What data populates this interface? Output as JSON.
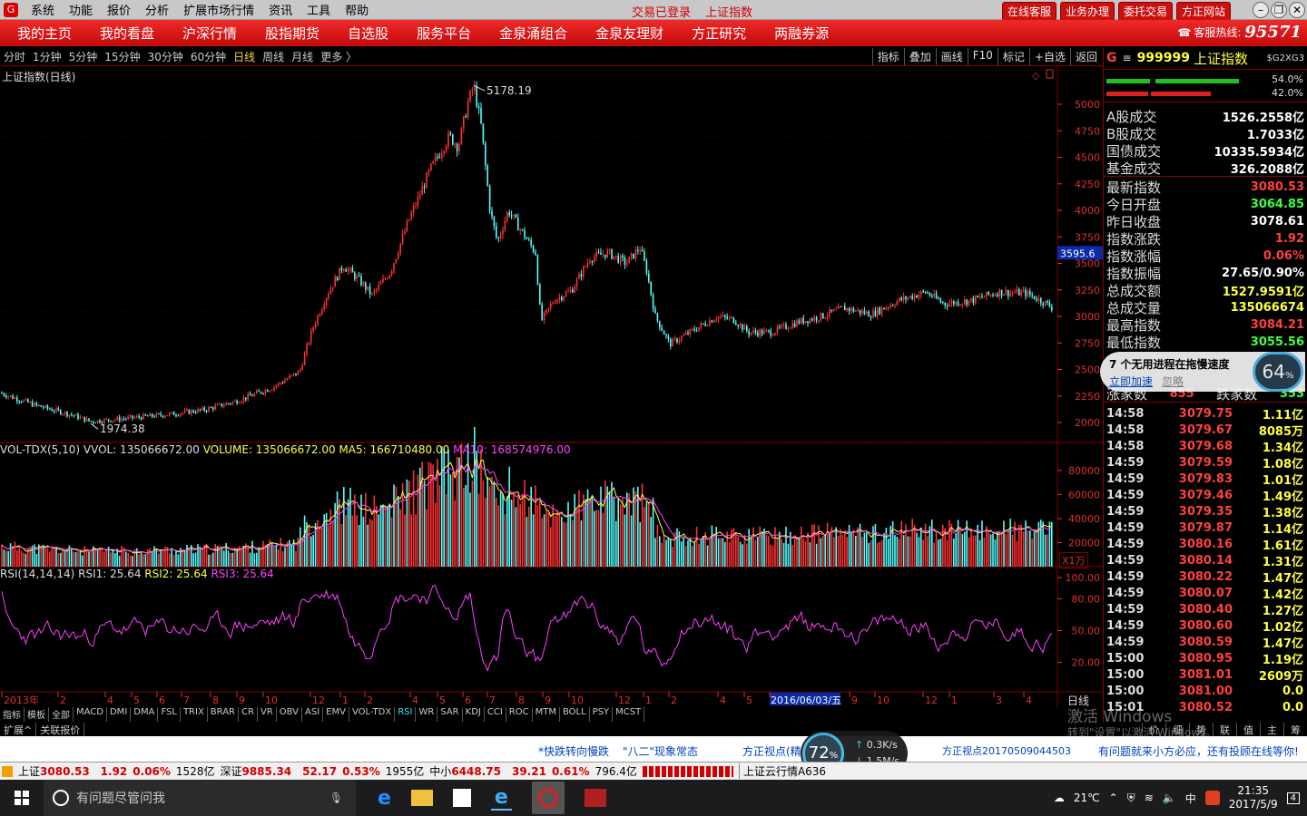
{
  "titlebar": {
    "logo": "G",
    "menu": [
      "系统",
      "功能",
      "报价",
      "分析",
      "扩展市场行情",
      "资讯",
      "工具",
      "帮助"
    ],
    "status_login": "交易已登录",
    "status_index": "上证指数",
    "buttons": [
      "在线客服",
      "业务办理",
      "委托交易",
      "方正网站"
    ]
  },
  "nav": {
    "items": [
      "我的主页",
      "我的看盘",
      "沪深行情",
      "股指期货",
      "自选股",
      "服务平台",
      "金泉涌组合",
      "金泉友理财",
      "方正研究",
      "两融券源"
    ],
    "hotline_label": "客服热线:",
    "hotline_number": "95571"
  },
  "periods": {
    "items": [
      "分时",
      "1分钟",
      "5分钟",
      "15分钟",
      "30分钟",
      "60分钟",
      "日线",
      "周线",
      "月线",
      "更多 〉"
    ],
    "active": "日线"
  },
  "toolbar": [
    "指标",
    "叠加",
    "画线",
    "F10",
    "标记",
    "+自选",
    "返回"
  ],
  "main_chart": {
    "title": "上证指数(日线)",
    "high_label": "5178.19",
    "low_label": "1974.38",
    "cursor_price": "3595.6",
    "y_ticks": [
      "5000",
      "4750",
      "4500",
      "4250",
      "4000",
      "3750",
      "3500",
      "3250",
      "3000",
      "2750",
      "2500",
      "2250",
      "2000"
    ],
    "colors": {
      "up": "#ff3232",
      "down": "#54ffff",
      "grid": "#800000"
    }
  },
  "volume_panel": {
    "title": "VOL-TDX(5,10)",
    "vvol": "VVOL: 135066672.00",
    "volume": "VOLUME: 135066672.00",
    "ma5": "MA5: 166710480.00",
    "ma10": "MA10: 168574976.00",
    "y_ticks": [
      "80000",
      "60000",
      "40000",
      "20000"
    ],
    "unit": "X1万"
  },
  "rsi_panel": {
    "title": "RSI(14,14,14)",
    "rsi1": "RSI1: 25.64",
    "rsi2": "RSI2: 25.64",
    "rsi3": "RSI3: 25.64",
    "y_ticks": [
      "100.00",
      "80.00",
      "50.00",
      "20.00"
    ]
  },
  "x_axis": {
    "labels": [
      "2013年",
      "2",
      "4",
      "5",
      "6",
      "7",
      "8",
      "9",
      "10",
      "12",
      "1",
      "2",
      "4",
      "5",
      "6",
      "7",
      "8",
      "9",
      "10",
      "12",
      "1",
      "2",
      "4",
      "5",
      "2016/06/03/五",
      "9",
      "10",
      "12",
      "1",
      "3",
      "4"
    ],
    "period_label": "日线"
  },
  "indicator_tabs": [
    "指标",
    "模板",
    "全部",
    "MACD",
    "DMI",
    "DMA",
    "FSL",
    "TRIX",
    "BRAR",
    "CR",
    "VR",
    "OBV",
    "ASI",
    "EMV",
    "VOL-TDX",
    "RSI",
    "WR",
    "SAR",
    "KDJ",
    "CCI",
    "ROC",
    "MTM",
    "BOLL",
    "PSY",
    "MCST"
  ],
  "active_indicator": "RSI",
  "bottom_tabs": [
    "扩展^",
    "关联报价"
  ],
  "right_panel": {
    "code": "999999",
    "name": "上证指数",
    "tag": "$G2XG3",
    "bar_pct1": "54.0%",
    "bar_pct2": "42.0%",
    "rows": [
      {
        "label": "A股成交",
        "value": "1526.2558亿",
        "color": "#ffffff"
      },
      {
        "label": "B股成交",
        "value": "1.7033亿",
        "color": "#ffffff"
      },
      {
        "label": "国债成交",
        "value": "10335.5934亿",
        "color": "#ffffff"
      },
      {
        "label": "基金成交",
        "value": "326.2088亿",
        "color": "#ffffff"
      },
      {
        "label": "最新指数",
        "value": "3080.53",
        "color": "#ff4040"
      },
      {
        "label": "今日开盘",
        "value": "3064.85",
        "color": "#40ff40"
      },
      {
        "label": "昨日收盘",
        "value": "3078.61",
        "color": "#ffffff"
      },
      {
        "label": "指数涨跌",
        "value": "1.92",
        "color": "#ff4040"
      },
      {
        "label": "指数涨幅",
        "value": "0.06%",
        "color": "#ff4040"
      },
      {
        "label": "指数振幅",
        "value": "27.65/0.90%",
        "color": "#ffffff"
      },
      {
        "label": "总成交额",
        "value": "1527.9591亿",
        "color": "#ffff40"
      },
      {
        "label": "总成交量",
        "value": "135066674",
        "color": "#ffff40"
      },
      {
        "label": "最高指数",
        "value": "3084.21",
        "color": "#ff4040"
      },
      {
        "label": "最低指数",
        "value": "3055.56",
        "color": "#40ff40"
      }
    ],
    "up_label": "涨家数",
    "up_count": "855",
    "down_label": "跌家数",
    "down_count": "353",
    "ticks": [
      {
        "t": "14:58",
        "p": "3079.75",
        "v": "1.11亿"
      },
      {
        "t": "14:58",
        "p": "3079.67",
        "v": "8085万"
      },
      {
        "t": "14:58",
        "p": "3079.68",
        "v": "1.34亿"
      },
      {
        "t": "14:59",
        "p": "3079.59",
        "v": "1.08亿"
      },
      {
        "t": "14:59",
        "p": "3079.83",
        "v": "1.01亿"
      },
      {
        "t": "14:59",
        "p": "3079.46",
        "v": "1.49亿"
      },
      {
        "t": "14:59",
        "p": "3079.35",
        "v": "1.38亿"
      },
      {
        "t": "14:59",
        "p": "3079.87",
        "v": "1.14亿"
      },
      {
        "t": "14:59",
        "p": "3080.16",
        "v": "1.61亿"
      },
      {
        "t": "14:59",
        "p": "3080.14",
        "v": "1.31亿"
      },
      {
        "t": "14:59",
        "p": "3080.22",
        "v": "1.47亿"
      },
      {
        "t": "14:59",
        "p": "3080.07",
        "v": "1.42亿"
      },
      {
        "t": "14:59",
        "p": "3080.40",
        "v": "1.27亿"
      },
      {
        "t": "14:59",
        "p": "3080.60",
        "v": "1.02亿"
      },
      {
        "t": "14:59",
        "p": "3080.59",
        "v": "1.47亿"
      },
      {
        "t": "15:00",
        "p": "3080.95",
        "v": "1.19亿"
      },
      {
        "t": "15:00",
        "p": "3081.01",
        "v": "2609万"
      },
      {
        "t": "15:00",
        "p": "3081.00",
        "v": "0.0"
      },
      {
        "t": "15:01",
        "p": "3080.52",
        "v": "0.0"
      }
    ],
    "bottom_tabs": [
      "价",
      "细",
      "势",
      "联",
      "值",
      "主",
      "筹"
    ]
  },
  "popup": {
    "title": "7 个无用进程在拖慢速度",
    "action": "立即加速",
    "ignore": "忽略",
    "percent": "64",
    "unit": "%"
  },
  "watermark": {
    "line1": "激活 Windows",
    "line2": "转到\"设置\"以激活 Windows。"
  },
  "ticker": {
    "items": [
      "*快跌转向慢跌",
      "\"八二\"现象常态",
      "方正视点(精",
      "方正视点20170509044503",
      "有问题就来小方必应，还有投顾在线等你!"
    ]
  },
  "speed": {
    "percent": "72",
    "unit": "%",
    "up": "0.3K/s",
    "down": "1.5M/s"
  },
  "statusbar": {
    "sh_label": "上证",
    "sh_val": "3080.53",
    "sh_chg": "1.92",
    "sh_pct": "0.06%",
    "sh_amt": "1528亿",
    "sz_label": "深证",
    "sz_val": "9885.34",
    "sz_chg": "52.17",
    "sz_pct": "0.53%",
    "sz_amt": "1955亿",
    "zx_label": "中小",
    "zx_val": "6448.75",
    "zx_chg": "39.21",
    "zx_pct": "0.61%",
    "zx_amt": "796.4亿",
    "server": "上证云行情A636"
  },
  "taskbar": {
    "search": "有问题尽管问我",
    "weather": "21℃",
    "ime": "中",
    "time": "21:35",
    "date": "2017/5/9",
    "notif": "4"
  }
}
